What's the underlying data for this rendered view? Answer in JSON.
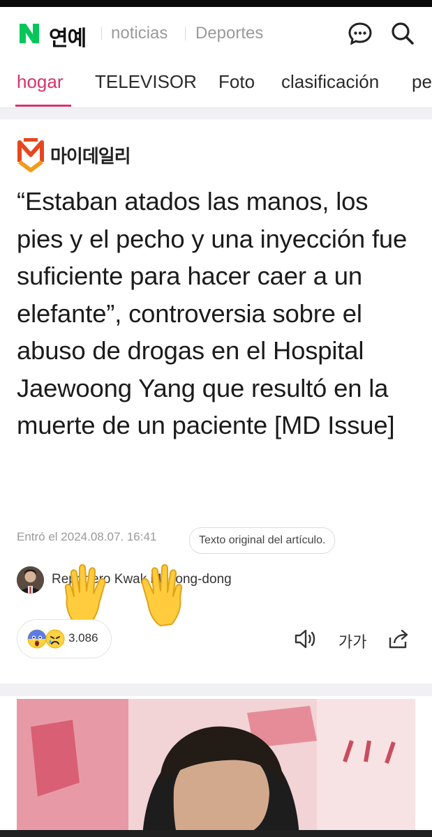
{
  "header": {
    "logo_letter": "N",
    "brand": "연예",
    "links": [
      "noticias",
      "Deportes"
    ],
    "brand_color": "#03c75a"
  },
  "tabs": [
    {
      "label": "hogar",
      "active": true
    },
    {
      "label": "TELEVISOR"
    },
    {
      "label": "Foto"
    },
    {
      "label": "clasificación"
    },
    {
      "label": "pe"
    }
  ],
  "article": {
    "press_name": "마이데일리",
    "headline": "“Estaban atados las manos, los pies y el pecho y una inyección fue suficiente para hacer caer a un elefante”, controversia sobre el abuso de drogas en el Hospital Jaewoong Yang que resultó en la muerte de un paciente [MD Issue]",
    "entered_label": "Entró el 2024.08.07. 16:41",
    "original_button": "Texto original del artículo.",
    "reporter": "Reportero Kwak Myeong-dong",
    "reaction_count": "3.086",
    "font_size_label": "가가"
  },
  "icons": {
    "comment": "chat-bubble-icon",
    "search": "search-icon",
    "speaker": "speaker-icon",
    "share": "share-icon"
  },
  "accent_color": "#d6336c"
}
